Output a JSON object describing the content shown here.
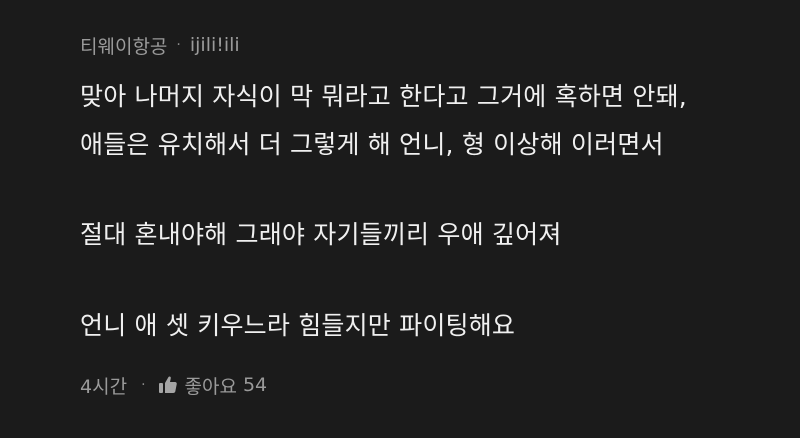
{
  "comment": {
    "author": "티웨이항공",
    "separator": "·",
    "handle": "ijili!ili",
    "lines": [
      "맞아 나머지 자식이 막 뭐라고 한다고 그거에 혹하면 안돼,",
      "애들은 유치해서 더 그렇게 해 언니, 형 이상해 이러면서",
      "절대 혼내야해 그래야 자기들끼리 우애 깊어져",
      "언니 애 셋 키우느라 힘들지만 파이팅해요"
    ],
    "footer": {
      "time": "4시간",
      "separator": "·",
      "like_icon": "thumbs-up-icon",
      "like_label": "좋아요",
      "like_count": "54"
    }
  },
  "colors": {
    "background": "#1b1b1b",
    "body_text": "#f0f0f0",
    "muted_text": "#9a9a9a"
  }
}
